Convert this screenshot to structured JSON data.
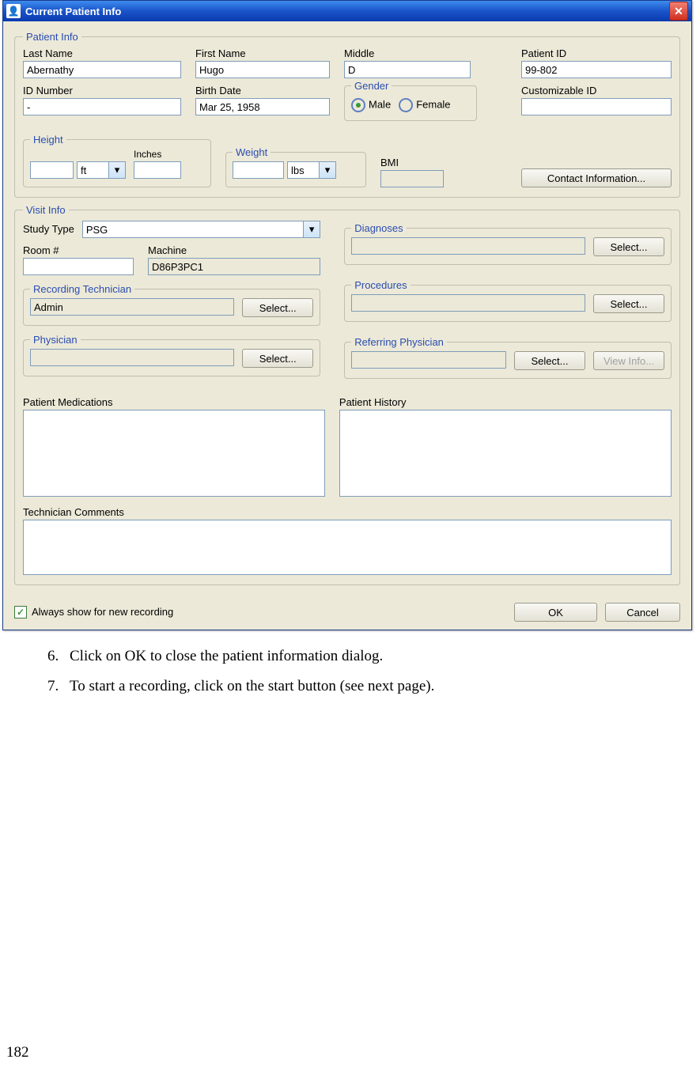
{
  "window": {
    "title": "Current Patient Info"
  },
  "patientInfo": {
    "legend": "Patient Info",
    "lastName": {
      "label": "Last Name",
      "value": "Abernathy"
    },
    "firstName": {
      "label": "First Name",
      "value": "Hugo"
    },
    "middle": {
      "label": "Middle",
      "value": "D"
    },
    "patientId": {
      "label": "Patient ID",
      "value": "99-802"
    },
    "idNumber": {
      "label": "ID Number",
      "value": "-"
    },
    "birthDate": {
      "label": "Birth Date",
      "value": "Mar 25, 1958"
    },
    "gender": {
      "legend": "Gender",
      "male": "Male",
      "female": "Female",
      "selected": "male"
    },
    "customId": {
      "label": "Customizable ID",
      "value": ""
    },
    "height": {
      "legend": "Height",
      "value": "",
      "unit": "ft",
      "inchesLabel": "Inches",
      "inches": ""
    },
    "weight": {
      "legend": "Weight",
      "value": "",
      "unit": "lbs"
    },
    "bmi": {
      "label": "BMI",
      "value": ""
    },
    "contactBtn": "Contact Information..."
  },
  "visitInfo": {
    "legend": "Visit Info",
    "studyType": {
      "label": "Study Type",
      "value": "PSG"
    },
    "room": {
      "label": "Room #",
      "value": ""
    },
    "machine": {
      "label": "Machine",
      "value": "D86P3PC1"
    },
    "recTech": {
      "legend": "Recording Technician",
      "value": "Admin",
      "selectBtn": "Select..."
    },
    "physician": {
      "legend": "Physician",
      "value": "",
      "selectBtn": "Select..."
    },
    "diagnoses": {
      "legend": "Diagnoses",
      "value": "",
      "selectBtn": "Select..."
    },
    "procedures": {
      "legend": "Procedures",
      "value": "",
      "selectBtn": "Select..."
    },
    "refPhys": {
      "legend": "Referring Physician",
      "value": "",
      "selectBtn": "Select...",
      "viewBtn": "View Info..."
    },
    "meds": {
      "label": "Patient Medications",
      "value": ""
    },
    "history": {
      "label": "Patient History",
      "value": ""
    },
    "techComments": {
      "label": "Technician Comments",
      "value": ""
    }
  },
  "footer": {
    "alwaysShow": "Always show for new recording",
    "ok": "OK",
    "cancel": "Cancel"
  },
  "instructions": {
    "item6": "Click on OK to close the patient information dialog.",
    "item7": "To start a recording, click on the start button (see next page)."
  },
  "pageNumber": "182"
}
